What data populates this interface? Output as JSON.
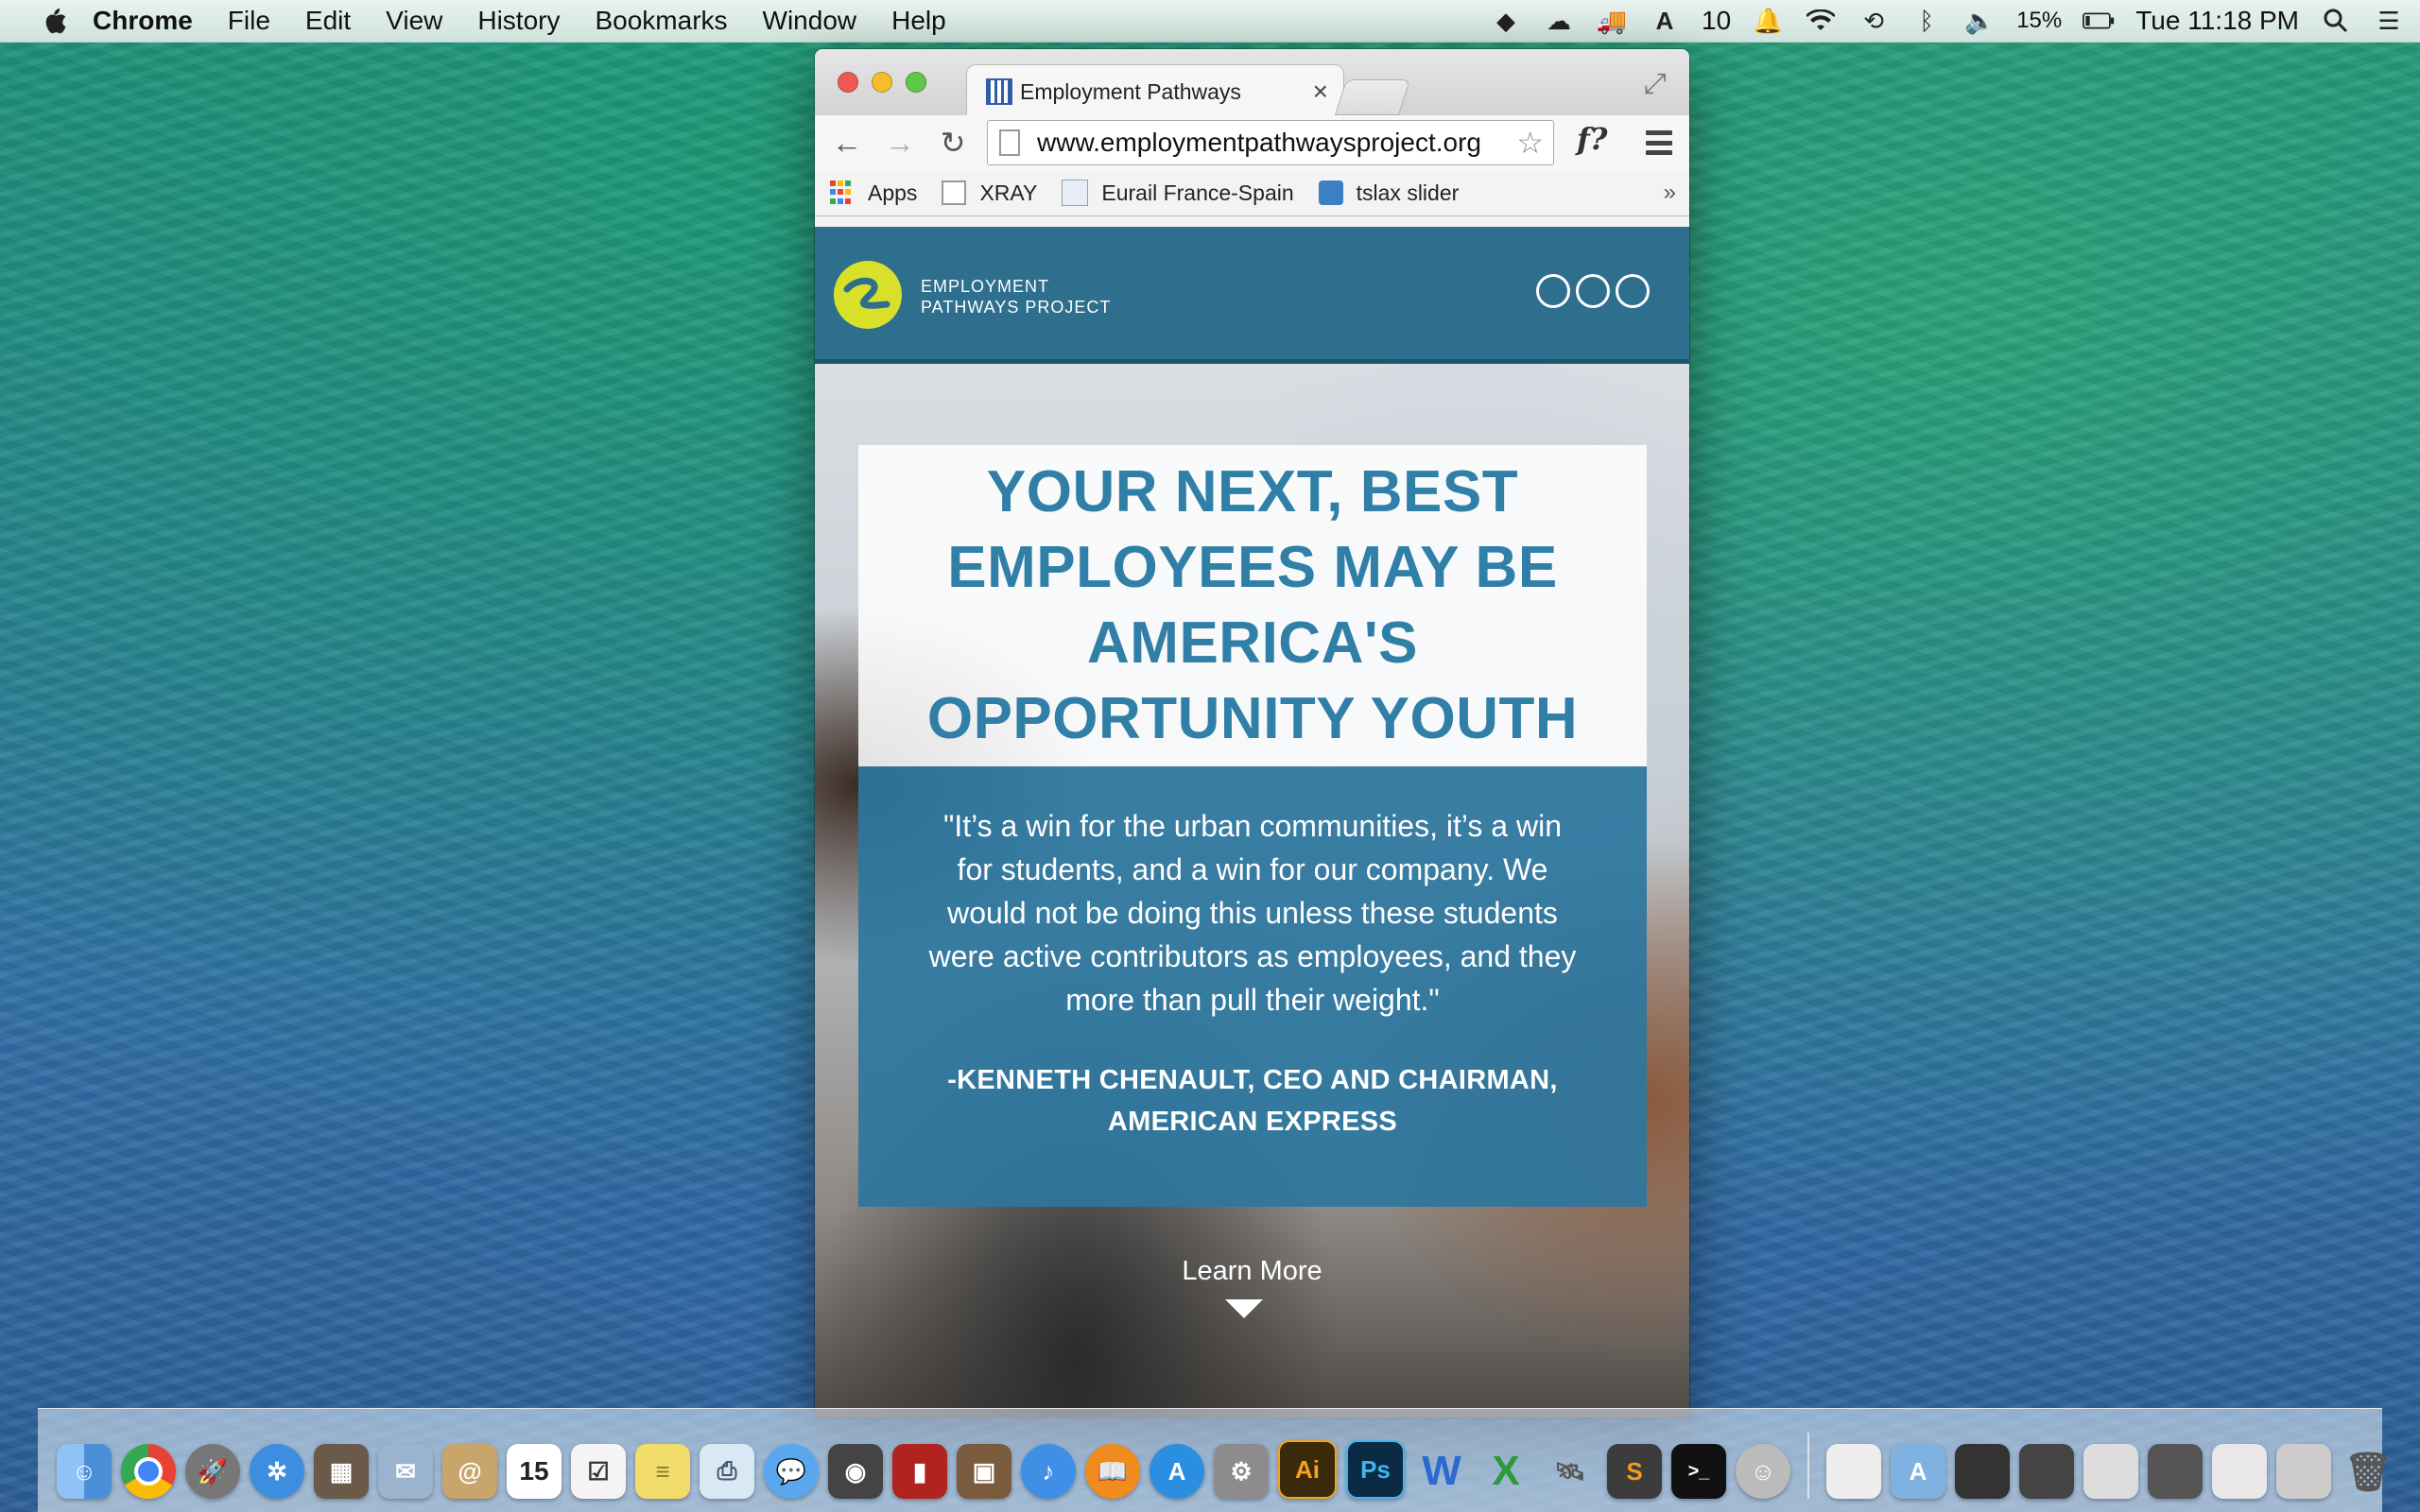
{
  "menubar": {
    "app_name": "Chrome",
    "menus": [
      "File",
      "Edit",
      "View",
      "History",
      "Bookmarks",
      "Window",
      "Help"
    ],
    "status": {
      "notification_count": "10",
      "battery": "15%",
      "clock": "Tue 11:18 PM"
    }
  },
  "browser": {
    "tab_title": "Employment Pathways",
    "url": "www.employmentpathwaysproject.org",
    "extension_label": "f?",
    "bookmarks": [
      "Apps",
      "XRAY",
      "Eurail France-Spain",
      "tslax slider"
    ],
    "overflow": "»"
  },
  "site": {
    "logo_line1": "EMPLOYMENT",
    "logo_line2": "PATHWAYS PROJECT",
    "headline": "YOUR NEXT, BEST EMPLOYEES MAY BE AMERICA'S OPPORTUNITY YOUTH",
    "quote": "\"It’s a win for the urban communities, it’s a win for students, and a win for our company. We would not be doing this unless these students were active contributors as employees, and they more than pull their weight.\"",
    "attribution": "-KENNETH CHENAULT, CEO AND CHAIRMAN, AMERICAN EXPRESS",
    "learn_more": "Learn More"
  },
  "dock": {
    "apps": [
      "Finder",
      "Chrome",
      "Launchpad",
      "Safari",
      "Photos",
      "Mail",
      "Contacts",
      "Calendar",
      "Reminders",
      "Notes",
      "Preview",
      "Messages",
      "FaceTime",
      "Photo Booth",
      "iPhoto",
      "iTunes",
      "iBooks",
      "App Store",
      "System Preferences",
      "Illustrator",
      "Photoshop",
      "Word",
      "Excel",
      "Network Utility",
      "Sublime Text",
      "Terminal",
      "Migration Assistant"
    ],
    "calendar_day": "15"
  },
  "colors": {
    "site_blue": "#2e6f8e",
    "headline_blue": "#2f7fa7",
    "logo_yellow": "#d8e02a"
  }
}
